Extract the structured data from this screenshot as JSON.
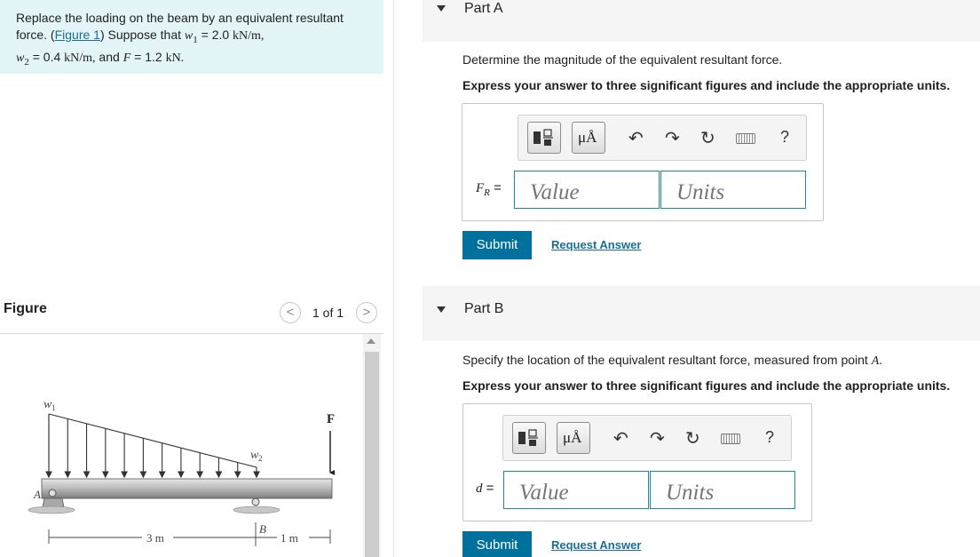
{
  "problem": {
    "text_before_link": "Replace the loading on the beam by an equivalent resultant force. (",
    "figure_link": "Figure 1",
    "text_after_link": ") Suppose that ",
    "w1_symbol": "w",
    "w1_sub": "1",
    "w1_value": " = 2.0 ",
    "w1_unit": "kN/m,",
    "w2_symbol": "w",
    "w2_sub": "2",
    "w2_value": " = 0.4 ",
    "w2_unit": "kN/m,",
    "and_text": " and ",
    "f_symbol": "F",
    "f_value": " = 1.2 ",
    "f_unit": "kN."
  },
  "figure_panel": {
    "title": "Figure",
    "prev": "<",
    "next": ">",
    "count": "1 of 1",
    "labels": {
      "w1": "w",
      "w1_sub": "1",
      "w2": "w",
      "w2_sub": "2",
      "F": "F",
      "A": "A",
      "B": "B",
      "dim1": "3 m",
      "dim2": "1 m"
    }
  },
  "partA": {
    "title": "Part A",
    "question": "Determine the magnitude of the equivalent resultant force.",
    "instruction": "Express your answer to three significant figures and include the appropriate units.",
    "label_main": "F",
    "label_sub": "R",
    "label_eq": " =",
    "value_placeholder": "Value",
    "units_placeholder": "Units",
    "units_button": "μÅ",
    "help": "?",
    "submit": "Submit",
    "request": "Request Answer"
  },
  "partB": {
    "title": "Part B",
    "question_before": "Specify the location of the equivalent resultant force, measured from point ",
    "question_point": "A",
    "question_after": ".",
    "instruction": "Express your answer to three significant figures and include the appropriate units.",
    "label_main": "d",
    "label_eq": " =",
    "value_placeholder": "Value",
    "units_placeholder": "Units",
    "units_button": "μÅ",
    "help": "?",
    "submit": "Submit",
    "request": "Request Answer"
  }
}
